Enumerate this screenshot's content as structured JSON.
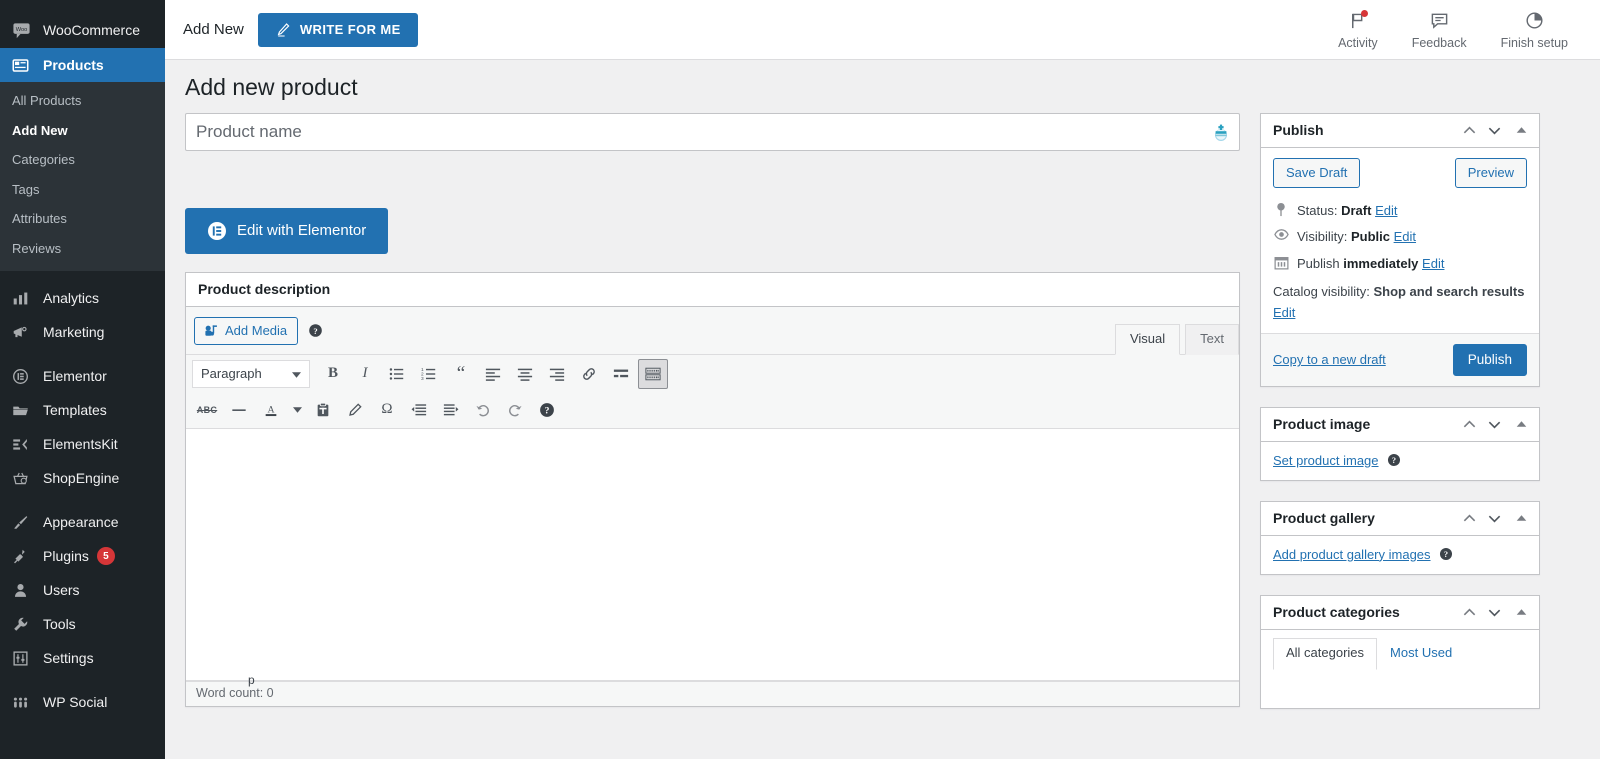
{
  "sidebar": {
    "brand": {
      "label": "WooCommerce",
      "icon": "woo-icon"
    },
    "items": [
      {
        "label": "Products",
        "icon": "products-icon",
        "current": true
      },
      {
        "label": "Analytics",
        "icon": "analytics-icon"
      },
      {
        "label": "Marketing",
        "icon": "marketing-megaphone-icon"
      },
      {
        "label": "Elementor",
        "icon": "elementor-icon"
      },
      {
        "label": "Templates",
        "icon": "folder-icon"
      },
      {
        "label": "ElementsKit",
        "icon": "elementskit-icon"
      },
      {
        "label": "ShopEngine",
        "icon": "shopengine-basket-icon"
      },
      {
        "label": "Appearance",
        "icon": "paintbrush-icon"
      },
      {
        "label": "Plugins",
        "icon": "plug-icon",
        "badge": "5"
      },
      {
        "label": "Users",
        "icon": "user-icon"
      },
      {
        "label": "Tools",
        "icon": "wrench-icon"
      },
      {
        "label": "Settings",
        "icon": "sliders-icon"
      },
      {
        "label": "WP Social",
        "icon": "wp-social-icon"
      }
    ],
    "submenu": [
      {
        "label": "All Products",
        "current": false
      },
      {
        "label": "Add New",
        "current": true
      },
      {
        "label": "Categories",
        "current": false
      },
      {
        "label": "Tags",
        "current": false
      },
      {
        "label": "Attributes",
        "current": false
      },
      {
        "label": "Reviews",
        "current": false
      }
    ]
  },
  "header": {
    "title": "Add New",
    "write_button": "WRITE FOR ME",
    "write_icon": "pencil-icon",
    "actions": [
      {
        "label": "Activity",
        "icon": "flag-icon",
        "has_dot": true
      },
      {
        "label": "Feedback",
        "icon": "speech-bubble-icon",
        "has_dot": false
      },
      {
        "label": "Finish setup",
        "icon": "pie-progress-icon",
        "has_dot": false
      }
    ]
  },
  "page": {
    "title": "Add new product",
    "product_name": {
      "value": "",
      "placeholder": "Product name"
    },
    "elementor_button": "Edit with Elementor"
  },
  "description_box": {
    "title": "Product description",
    "add_media": "Add Media",
    "tabs": [
      {
        "label": "Visual",
        "active": true
      },
      {
        "label": "Text",
        "active": false
      }
    ],
    "format_select": "Paragraph",
    "toolbar_row1": [
      {
        "name": "bold-icon",
        "glyph": "B"
      },
      {
        "name": "italic-icon",
        "glyph": "I"
      },
      {
        "name": "bulleted-list-icon",
        "glyph": ""
      },
      {
        "name": "numbered-list-icon",
        "glyph": ""
      },
      {
        "name": "blockquote-icon",
        "glyph": "“"
      },
      {
        "name": "align-left-icon",
        "glyph": ""
      },
      {
        "name": "align-center-icon",
        "glyph": ""
      },
      {
        "name": "align-right-icon",
        "glyph": ""
      },
      {
        "name": "insert-link-icon",
        "glyph": ""
      },
      {
        "name": "read-more-icon",
        "glyph": ""
      },
      {
        "name": "toolbar-toggle-icon",
        "glyph": "",
        "active": true
      }
    ],
    "toolbar_row2": [
      {
        "name": "strikethrough-icon",
        "glyph": "ABC"
      },
      {
        "name": "horizontal-rule-icon",
        "glyph": "—"
      },
      {
        "name": "text-color-icon",
        "glyph": "A"
      },
      {
        "name": "text-color-caret-icon",
        "glyph": "▾"
      },
      {
        "name": "paste-as-text-icon",
        "glyph": ""
      },
      {
        "name": "clear-formatting-icon",
        "glyph": ""
      },
      {
        "name": "special-character-icon",
        "glyph": "Ω"
      },
      {
        "name": "decrease-indent-icon",
        "glyph": ""
      },
      {
        "name": "increase-indent-icon",
        "glyph": ""
      },
      {
        "name": "undo-icon",
        "glyph": ""
      },
      {
        "name": "redo-icon",
        "glyph": ""
      },
      {
        "name": "keyboard-shortcuts-icon",
        "glyph": ""
      }
    ],
    "content": "",
    "path_crumb": "p",
    "word_count": "Word count: 0"
  },
  "publish_box": {
    "title": "Publish",
    "save_draft": "Save Draft",
    "preview": "Preview",
    "status_label": "Status:",
    "status_value": "Draft",
    "status_edit": "Edit",
    "visibility_label": "Visibility:",
    "visibility_value": "Public",
    "visibility_edit": "Edit",
    "publish_label": "Publish",
    "publish_value": "immediately",
    "publish_edit": "Edit",
    "catalog_label": "Catalog visibility:",
    "catalog_value": "Shop and search results",
    "catalog_edit": "Edit",
    "copy_draft": "Copy to a new draft",
    "publish_button": "Publish"
  },
  "product_image_box": {
    "title": "Product image",
    "link": "Set product image"
  },
  "product_gallery_box": {
    "title": "Product gallery",
    "link": "Add product gallery images"
  },
  "product_categories_box": {
    "title": "Product categories",
    "tabs": [
      {
        "label": "All categories",
        "active": true
      },
      {
        "label": "Most Used",
        "active": false
      }
    ]
  },
  "colors": {
    "accent_blue": "#2271b1",
    "sidebar_bg": "#1d2327",
    "submenu_bg": "#2c3338",
    "badge_red": "#d63638",
    "page_bg": "#f0f0f1"
  }
}
